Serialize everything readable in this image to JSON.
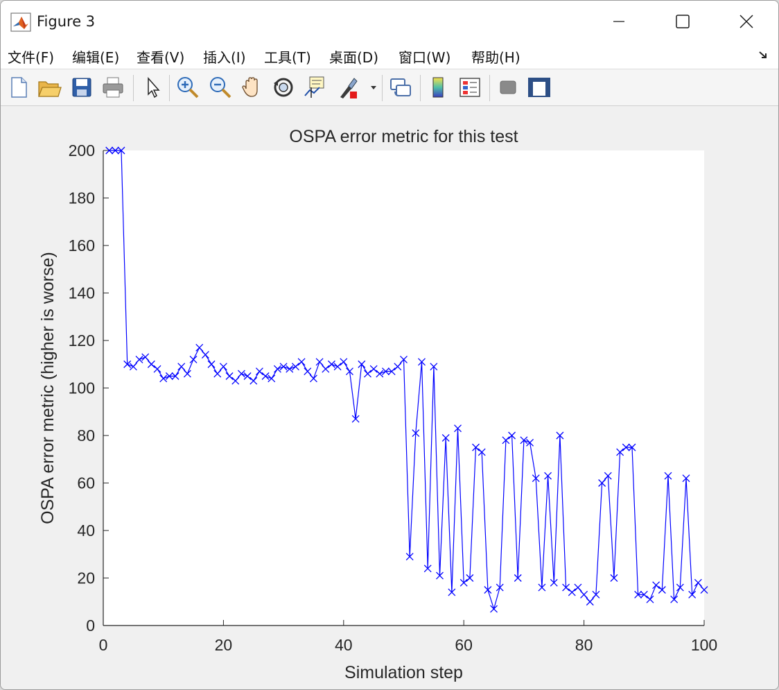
{
  "window": {
    "title": "Figure 3"
  },
  "menu": {
    "items": [
      {
        "label": "文件(F)",
        "name": "menu-file"
      },
      {
        "label": "编辑(E)",
        "name": "menu-edit"
      },
      {
        "label": "查看(V)",
        "name": "menu-view"
      },
      {
        "label": "插入(I)",
        "name": "menu-insert"
      },
      {
        "label": "工具(T)",
        "name": "menu-tools"
      },
      {
        "label": "桌面(D)",
        "name": "menu-desktop"
      },
      {
        "label": "窗口(W)",
        "name": "menu-window"
      },
      {
        "label": "帮助(H)",
        "name": "menu-help"
      }
    ]
  },
  "toolbar": {
    "icons": [
      "new-figure-icon",
      "open-file-icon",
      "save-icon",
      "print-icon",
      "select-arrow-icon",
      "zoom-in-icon",
      "zoom-out-icon",
      "pan-hand-icon",
      "rotate-3d-icon",
      "data-cursor-icon",
      "brush-icon",
      "link-plot-icon",
      "colorbar-icon",
      "legend-icon",
      "hide-plot-tools-icon",
      "show-plot-tools-icon"
    ]
  },
  "colors": {
    "line": "#0000ff",
    "axes_bg": "#ffffff",
    "figure_bg": "#f0f0f0"
  },
  "chart_data": {
    "type": "line",
    "title": "OSPA error metric for this test",
    "xlabel": "Simulation step",
    "ylabel": "OSPA error metric (higher is worse)",
    "xlim": [
      0,
      100
    ],
    "ylim": [
      0,
      200
    ],
    "xticks": [
      0,
      20,
      40,
      60,
      80,
      100
    ],
    "yticks": [
      0,
      20,
      40,
      60,
      80,
      100,
      120,
      140,
      160,
      180,
      200
    ],
    "marker": "x",
    "grid": false,
    "series": [
      {
        "x": [
          1,
          2,
          3,
          4,
          5,
          6,
          7,
          8,
          9,
          10,
          11,
          12,
          13,
          14,
          15,
          16,
          17,
          18,
          19,
          20,
          21,
          22,
          23,
          24,
          25,
          26,
          27,
          28,
          29,
          30,
          31,
          32,
          33,
          34,
          35,
          36,
          37,
          38,
          39,
          40,
          41,
          42,
          43,
          44,
          45,
          46,
          47,
          48,
          49,
          50,
          51,
          52,
          53,
          54,
          55,
          56,
          57,
          58,
          59,
          60,
          61,
          62,
          63,
          64,
          65,
          66,
          67,
          68,
          69,
          70,
          71,
          72,
          73,
          74,
          75,
          76,
          77,
          78,
          79,
          80,
          81,
          82,
          83,
          84,
          85,
          86,
          87,
          88,
          89,
          90,
          91,
          92,
          93,
          94,
          95,
          96,
          97,
          98,
          99,
          100
        ],
        "y": [
          200,
          200,
          200,
          110,
          109,
          112,
          113,
          110,
          108,
          104,
          105,
          105,
          109,
          106,
          112,
          117,
          114,
          110,
          106,
          109,
          105,
          103,
          106,
          105,
          103,
          107,
          105,
          104,
          108,
          109,
          108,
          109,
          111,
          107,
          104,
          111,
          108,
          110,
          109,
          111,
          107,
          87,
          110,
          106,
          108,
          106,
          107,
          107,
          109,
          112,
          29,
          81,
          111,
          24,
          109,
          21,
          79,
          14,
          83,
          18,
          20,
          75,
          73,
          15,
          7,
          16,
          78,
          80,
          20,
          78,
          77,
          62,
          16,
          63,
          18,
          80,
          16,
          14,
          16,
          13,
          10,
          13,
          60,
          63,
          20,
          73,
          75,
          75,
          13,
          13,
          11,
          17,
          15,
          63,
          11,
          16,
          62,
          13,
          18,
          15
        ]
      }
    ]
  }
}
